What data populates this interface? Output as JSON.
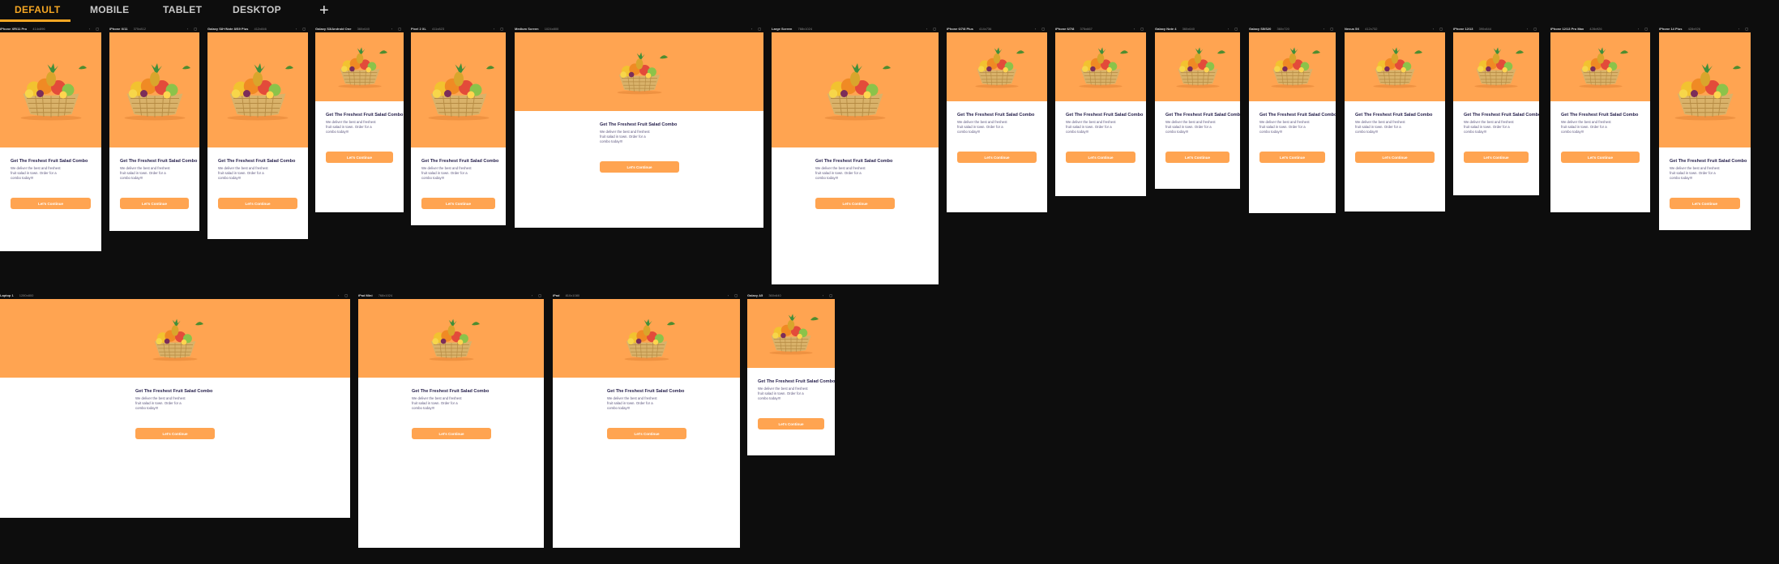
{
  "tabs": [
    {
      "label": "DEFAULT",
      "active": true
    },
    {
      "label": "MOBILE",
      "active": false
    },
    {
      "label": "TABLET",
      "active": false
    },
    {
      "label": "DESKTOP",
      "active": false
    }
  ],
  "add_tab_label": "+",
  "frame_controls": "◦ ▢",
  "screen": {
    "title": "Get The Freshest Fruit Salad Combo",
    "description": "We deliver the best and freshest fruit salad in town. Order for a combo today!!!",
    "cta_label": "Let's Continue"
  },
  "colors": {
    "accent": "#ffa451",
    "tab_active": "#f5a623",
    "background": "#0d0d0d",
    "text_dark": "#27214d"
  },
  "devices": [
    {
      "name": "iPhone XR/11 Pro",
      "size": "414x896"
    },
    {
      "name": "iPhone X/11",
      "size": "375x812"
    },
    {
      "name": "Galaxy S8+/Note 8/S9 Plus",
      "size": "412x846"
    },
    {
      "name": "Galaxy S3/Android One",
      "size": "360x640"
    },
    {
      "name": "Pixel 2 XL",
      "size": "411x823"
    },
    {
      "name": "Medium Screen",
      "size": "1024x800"
    },
    {
      "name": "Large Screen",
      "size": "768x1024"
    },
    {
      "name": "iPhone 6/7/8 Plus",
      "size": "414x736"
    },
    {
      "name": "iPhone 6/7/8",
      "size": "375x667"
    },
    {
      "name": "Galaxy Note 4",
      "size": "360x640"
    },
    {
      "name": "Galaxy S5/S20",
      "size": "360x720"
    },
    {
      "name": "Nexus 5X",
      "size": "412x732"
    },
    {
      "name": "iPhone 12/13",
      "size": "390x844"
    },
    {
      "name": "iPhone 12/13 Pro Max",
      "size": "428x926"
    },
    {
      "name": "iPhone 14 Plus",
      "size": "428x926"
    },
    {
      "name": "Laptop 1",
      "size": "1280x800"
    },
    {
      "name": "iPad Mini",
      "size": "768x1024"
    },
    {
      "name": "iPad",
      "size": "810x1080"
    },
    {
      "name": "Galaxy A5",
      "size": "360x640"
    }
  ]
}
